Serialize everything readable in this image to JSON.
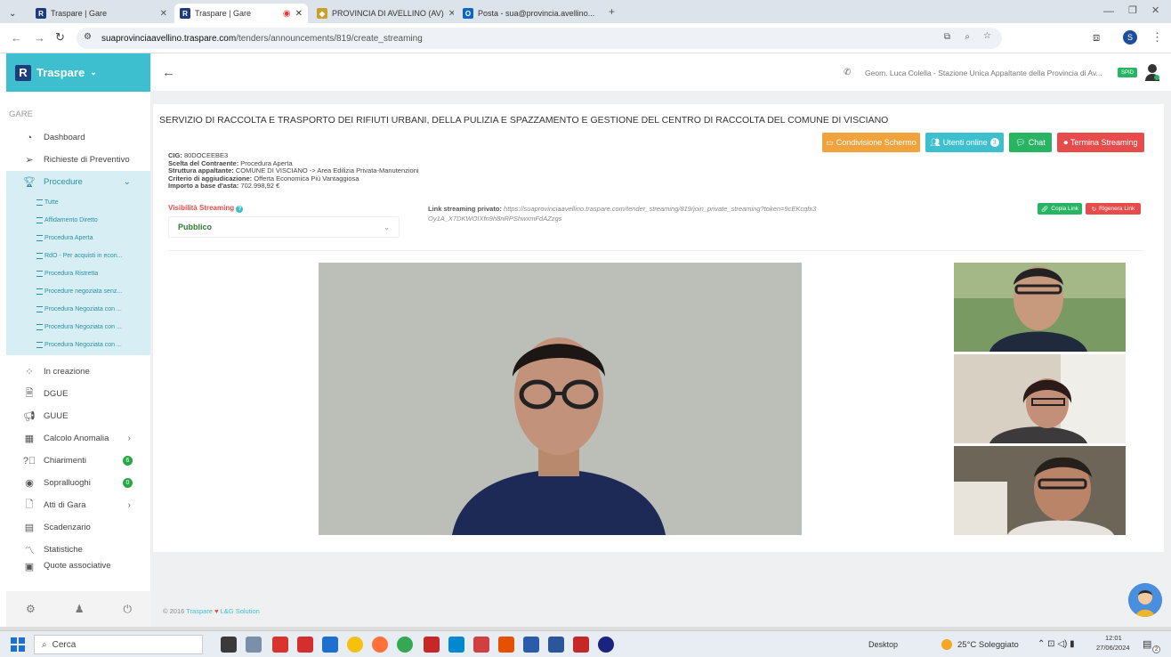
{
  "browser": {
    "tabs": [
      {
        "label": "Traspare | Gare",
        "active": false
      },
      {
        "label": "Traspare | Gare",
        "active": true
      },
      {
        "label": "PROVINCIA DI AVELLINO (AV)",
        "active": false
      },
      {
        "label": "Posta - sua@provincia.avellino...",
        "active": false
      }
    ],
    "url_host": "suaprovinciaavellino.traspare.com",
    "url_path": "/tenders/announcements/819/create_streaming"
  },
  "sidebar": {
    "brand": "Traspare",
    "section": "GARE",
    "items_top": [
      {
        "label": "Dashboard",
        "icon": "dashboard-icon"
      },
      {
        "label": "Richieste di Preventivo",
        "icon": "send-icon"
      },
      {
        "label": "Procedure",
        "icon": "trophy-icon"
      }
    ],
    "procedure_subitems": [
      "Tutte",
      "Affidamento Diretto",
      "Procedura Aperta",
      "RdO - Per acquisti in econ...",
      "Procedura Ristretta",
      "Procedure negoziata senz...",
      "Procedura Negoziata con ...",
      "Procedura Negoziata con ...",
      "Procedura Negoziata con ..."
    ],
    "items_bottom": [
      {
        "label": "In creazione",
        "icon": "spinner-icon"
      },
      {
        "label": "DGUE",
        "icon": "document-icon"
      },
      {
        "label": "GUUE",
        "icon": "megaphone-icon"
      },
      {
        "label": "Calcolo Anomalia",
        "icon": "calculator-icon"
      },
      {
        "label": "Chiarimenti",
        "icon": "question-icon",
        "badge": "6"
      },
      {
        "label": "Sopralluoghi",
        "icon": "eye-icon",
        "badge": "0"
      },
      {
        "label": "Atti di Gara",
        "icon": "file-icon"
      },
      {
        "label": "Scadenzario",
        "icon": "calendar-icon"
      },
      {
        "label": "Statistiche",
        "icon": "chart-icon"
      },
      {
        "label": "Quote associative",
        "icon": "wallet-icon"
      }
    ]
  },
  "header": {
    "user": "Geom. Luca Colella - Stazione Unica Appaltante della Provincia di Av...",
    "spid": "SPID"
  },
  "main": {
    "title": "SERVIZIO DI RACCOLTA E TRASPORTO DEI RIFIUTI URBANI, DELLA PULIZIA E SPAZZAMENTO E GESTIONE DEL CENTRO DI RACCOLTA DEL COMUNE DI VISCIANO",
    "buttons": {
      "screen": "Condivisione Schermo",
      "users": "Utenti online",
      "users_count": "3",
      "chat": "Chat",
      "end": "Termina Streaming"
    },
    "colors": {
      "orange": "#f0a23d",
      "teal": "#3dbfcf",
      "green": "#28b463",
      "red": "#e74c4c"
    },
    "info": {
      "cig_label": "CIG:",
      "cig": "80DOCEEBE3",
      "contractor_label": "Scelta del Contraente:",
      "contractor": "Procedura Aperta",
      "structure_label": "Struttura appaltante:",
      "structure": "COMUNE DI VISCIANO -> Area Edilizia Privata-Manutenzioni",
      "criterion_label": "Criterio di aggiudicazione:",
      "criterion": "Offerta Economica Più Vantaggiosa",
      "amount_label": "Importo a base d'asta:",
      "amount": "702.998,92 €"
    },
    "visibility_label": "Visibilità Streaming",
    "visibility_value": "Pubblico",
    "link_label": "Link streaming privato:",
    "link_value": "https://suaprovinciaavellino.traspare.com/tender_streaming/819/join_private_streaming?token=9cEKcqfx3Oy1A_X7DKWOIXfn9h8nRPShwxmFdAZzgs",
    "copy_link": "Copia Link",
    "regen_link": "Rigenera Link"
  },
  "footer": {
    "prefix": "© 2016",
    "brand": "Traspare",
    "suffix": "L&G Solution"
  },
  "taskbar": {
    "search": "Cerca",
    "desktop": "Desktop",
    "weather": "25°C Soleggiato",
    "time": "12:01",
    "date": "27/06/2024",
    "notifications": "2"
  }
}
